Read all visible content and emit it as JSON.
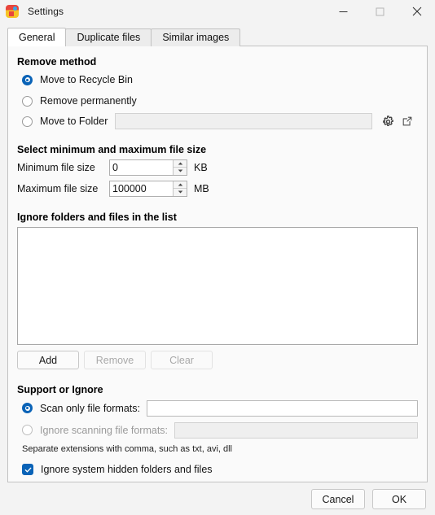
{
  "window": {
    "title": "Settings",
    "icon": "app-icon",
    "controls": {
      "minimize": "minimize-icon",
      "maximize": "maximize-icon",
      "close": "close-icon"
    }
  },
  "tabs": [
    {
      "label": "General",
      "active": true
    },
    {
      "label": "Duplicate files",
      "active": false
    },
    {
      "label": "Similar images",
      "active": false
    }
  ],
  "remove_method": {
    "title": "Remove method",
    "options": [
      {
        "label": "Move to Recycle Bin",
        "selected": true
      },
      {
        "label": "Remove permanently",
        "selected": false
      },
      {
        "label": "Move to Folder",
        "selected": false
      }
    ],
    "folder_path_value": "",
    "folder_path_placeholder": "",
    "settings_icon": "gear-icon",
    "open_icon": "external-link-icon"
  },
  "file_size": {
    "title": "Select minimum and maximum file size",
    "minimum": {
      "label": "Minimum file size",
      "value": "0",
      "unit": "KB"
    },
    "maximum": {
      "label": "Maximum file size",
      "value": "100000",
      "unit": "MB"
    }
  },
  "ignore_list": {
    "title": "Ignore folders and files in the list",
    "items": [],
    "buttons": [
      {
        "label": "Add",
        "enabled": true
      },
      {
        "label": "Remove",
        "enabled": false
      },
      {
        "label": "Clear",
        "enabled": false
      }
    ]
  },
  "support_ignore": {
    "title": "Support or Ignore",
    "scan_only": {
      "label": "Scan only file formats:",
      "selected": true,
      "value": "",
      "enabled": true
    },
    "ignore_scanning": {
      "label": "Ignore scanning file formats:",
      "selected": false,
      "value": "",
      "enabled": false
    },
    "hint": "Separate extensions with comma, such as txt, avi, dll",
    "hidden_files": {
      "label": "Ignore system hidden folders and files",
      "checked": true
    }
  },
  "footer": {
    "cancel_label": "Cancel",
    "ok_label": "OK"
  },
  "colors": {
    "accent": "#0a63b7",
    "dialog_bg": "#f3f3f3",
    "panel_bg": "#fafafa",
    "field_bg": "#ffffff",
    "disabled_text": "#9a9a9a"
  }
}
